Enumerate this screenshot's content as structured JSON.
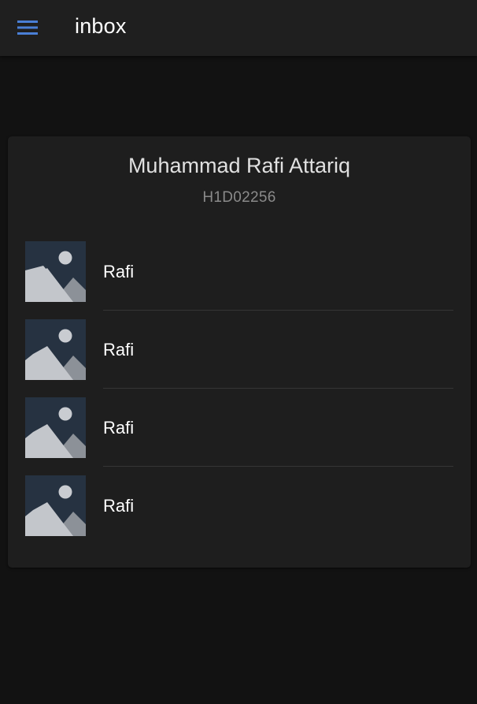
{
  "toolbar": {
    "title": "inbox",
    "menu_icon": "hamburger-menu-icon",
    "accent_color": "#4a7fd6"
  },
  "card": {
    "title": "Muhammad Rafi Attariq",
    "subtitle": "H1D02256"
  },
  "list": {
    "items": [
      {
        "label": "Rafi",
        "thumbnail_icon": "image-placeholder-icon"
      },
      {
        "label": "Rafi",
        "thumbnail_icon": "image-placeholder-icon"
      },
      {
        "label": "Rafi",
        "thumbnail_icon": "image-placeholder-icon"
      },
      {
        "label": "Rafi",
        "thumbnail_icon": "image-placeholder-icon"
      }
    ]
  }
}
